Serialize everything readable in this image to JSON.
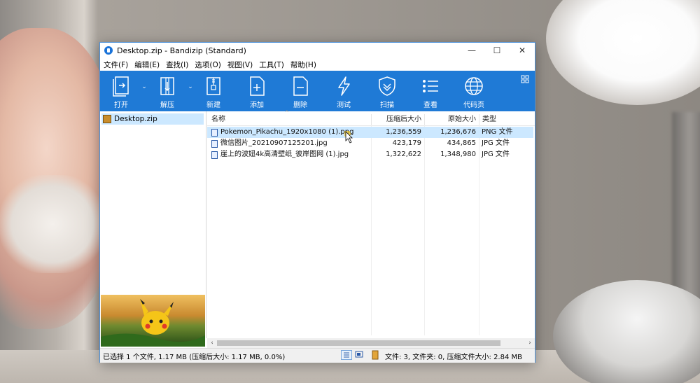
{
  "window": {
    "title": "Desktop.zip - Bandizip (Standard)",
    "controls": {
      "minimize": "—",
      "maximize": "☐",
      "close": "✕"
    }
  },
  "menu": [
    "文件(F)",
    "编辑(E)",
    "查找(I)",
    "选项(O)",
    "视图(V)",
    "工具(T)",
    "帮助(H)"
  ],
  "toolbar": {
    "open": "打开",
    "extract": "解压",
    "new": "新建",
    "add": "添加",
    "delete": "删除",
    "test": "测试",
    "scan": "扫描",
    "view": "查看",
    "codepage": "代码页"
  },
  "tree": {
    "root": "Desktop.zip"
  },
  "columns": {
    "name": "名称",
    "compressed": "压缩后大小",
    "original": "原始大小",
    "type": "类型"
  },
  "files": [
    {
      "name": "Pokemon_Pikachu_1920x1080 (1).png",
      "compressed": "1,236,559",
      "original": "1,236,676",
      "type": "PNG 文件",
      "selected": true
    },
    {
      "name": "微信图片_20210907125201.jpg",
      "compressed": "423,179",
      "original": "434,865",
      "type": "JPG 文件",
      "selected": false
    },
    {
      "name": "崖上的波妞4k高清壁纸_彼岸图网 (1).jpg",
      "compressed": "1,322,622",
      "original": "1,348,980",
      "type": "JPG 文件",
      "selected": false
    }
  ],
  "status": {
    "left": "已选择 1 个文件, 1.17 MB (压缩后大小: 1.17 MB, 0.0%)",
    "right": "文件: 3, 文件夹: 0, 压缩文件大小: 2.84 MB"
  },
  "colors": {
    "toolbar": "#1f7ad6",
    "selection": "#cce8ff"
  }
}
